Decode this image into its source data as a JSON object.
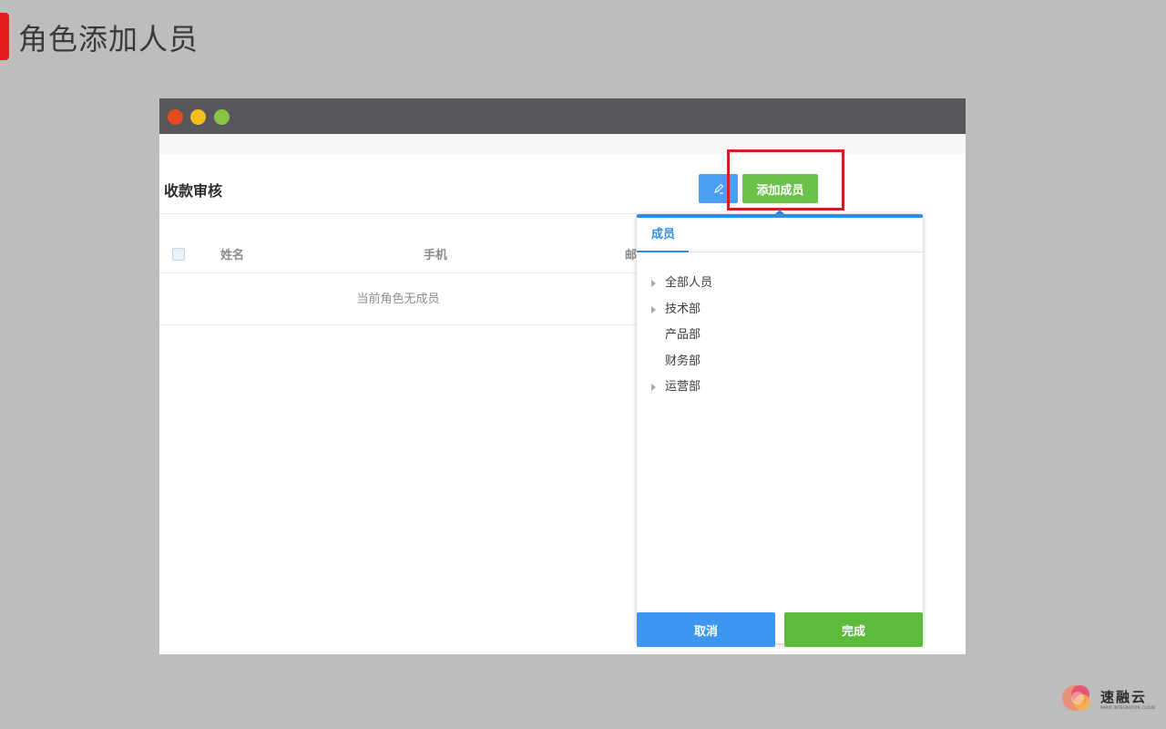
{
  "slide": {
    "title": "角色添加人员"
  },
  "window": {
    "page_title": "收款审核",
    "toolbar": {
      "edit_icon": "pencil-icon",
      "add_member_label": "添加成员"
    },
    "table": {
      "columns": [
        "姓名",
        "手机",
        "邮"
      ],
      "empty_text": "当前角色无成员"
    }
  },
  "panel": {
    "tab_label": "成员",
    "tree": [
      {
        "label": "全部人员",
        "expandable": true
      },
      {
        "label": "技术部",
        "expandable": true
      },
      {
        "label": "产品部",
        "expandable": false
      },
      {
        "label": "财务部",
        "expandable": false
      },
      {
        "label": "运营部",
        "expandable": true
      }
    ],
    "cancel_label": "取消",
    "done_label": "完成"
  },
  "brand": {
    "name": "速融云",
    "sub": "RAPID INTEGRATION CLOUD"
  },
  "colors": {
    "accent_blue": "#2e8de8",
    "accent_green": "#6cc14b",
    "highlight_red": "#d21f1f"
  }
}
